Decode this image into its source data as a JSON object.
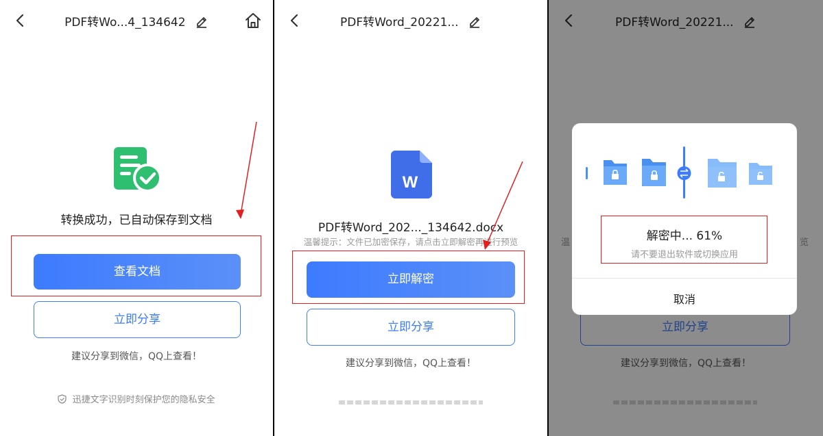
{
  "panel1": {
    "title": "PDF转Wo...4_134642",
    "success_text": "转换成功，已自动保存到文档",
    "view_button": "查看文档",
    "share_button": "立即分享",
    "share_hint": "建议分享到微信，QQ上查看！",
    "privacy": "迅捷文字识别时刻保护您的隐私安全"
  },
  "panel2": {
    "title": "PDF转Word_20221...",
    "filename": "PDF转Word_202..._134642.docx",
    "tip": "温馨提示：文件已加密保存，请点击立即解密再进行预览",
    "decrypt_button": "立即解密",
    "share_button": "立即分享",
    "share_hint": "建议分享到微信，QQ上查看！",
    "word_letter": "W"
  },
  "panel3": {
    "title": "PDF转Word_20221...",
    "progress_label": "解密中... 61%",
    "progress_value": 61,
    "warning": "请不要退出软件或切换应用",
    "cancel_button": "取消",
    "share_button": "立即分享",
    "share_hint": "建议分享到微信，QQ上查看！",
    "bg_left_fragment": "温",
    "bg_right_fragment": "览"
  },
  "colors": {
    "primary": "#3d7bff",
    "success_green": "#2fbf71",
    "annotation_red": "#e02020"
  },
  "icons": [
    "back-icon",
    "pencil-icon",
    "home-icon",
    "document-check-icon",
    "word-file-icon",
    "locked-folder-icon",
    "unlocked-folder-icon",
    "swap-icon",
    "shield-icon"
  ]
}
